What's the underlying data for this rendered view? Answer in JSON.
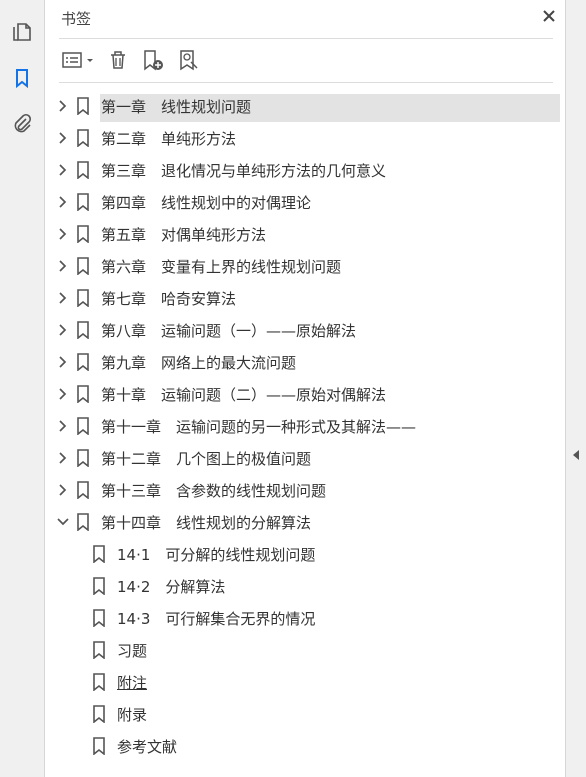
{
  "panel": {
    "title": "书签"
  },
  "bookmarks": [
    {
      "label": "第一章　线性规划问题",
      "expanded": false,
      "selected": true
    },
    {
      "label": "第二章　单纯形方法",
      "expanded": false
    },
    {
      "label": "第三章　退化情况与单纯形方法的几何意义",
      "expanded": false
    },
    {
      "label": "第四章　线性规划中的对偶理论",
      "expanded": false
    },
    {
      "label": "第五章　对偶单纯形方法",
      "expanded": false
    },
    {
      "label": "第六章　变量有上界的线性规划问题",
      "expanded": false
    },
    {
      "label": "第七章　哈奇安算法",
      "expanded": false
    },
    {
      "label": "第八章　运输问题（一）——原始解法",
      "expanded": false
    },
    {
      "label": "第九章　网络上的最大流问题",
      "expanded": false
    },
    {
      "label": "第十章　运输问题（二）——原始对偶解法",
      "expanded": false
    },
    {
      "label": "第十一章　运输问题的另一种形式及其解法——",
      "expanded": false
    },
    {
      "label": "第十二章　几个图上的极值问题",
      "expanded": false
    },
    {
      "label": "第十三章　含参数的线性规划问题",
      "expanded": false
    },
    {
      "label": "第十四章　线性规划的分解算法",
      "expanded": true
    }
  ],
  "sub_bookmarks": [
    {
      "label": "14·1　可分解的线性规划问题"
    },
    {
      "label": "14·2　分解算法"
    },
    {
      "label": "14·3　可行解集合无界的情况"
    },
    {
      "label": "习题"
    },
    {
      "label": "附注"
    },
    {
      "label": "附录"
    },
    {
      "label": "参考文献"
    }
  ],
  "icons": {
    "rail": [
      "pages-icon",
      "bookmark-icon",
      "attachment-icon"
    ],
    "toolbar": [
      "options-menu-icon",
      "delete-icon",
      "new-bookmark-icon",
      "bookmark-search-icon"
    ]
  },
  "colors": {
    "accent": "#1473e6",
    "selected_bg": "#e3e3e3",
    "rail_bg": "#f0f0f0"
  }
}
